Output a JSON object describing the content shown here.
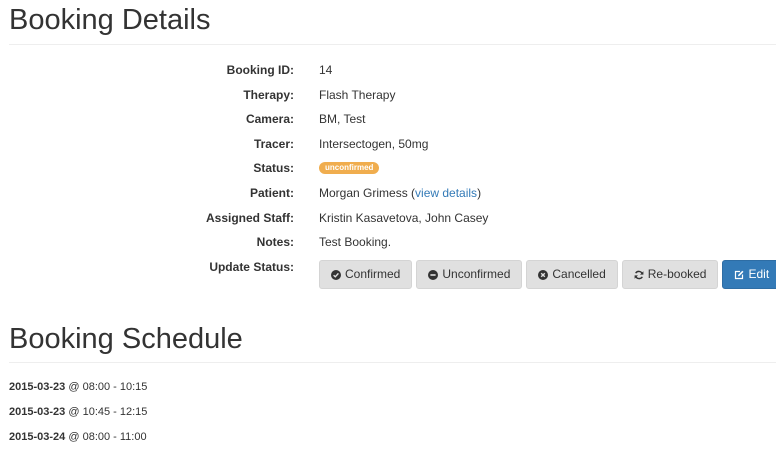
{
  "details": {
    "title": "Booking Details",
    "rows": [
      {
        "label": "Booking ID:",
        "value": "14"
      },
      {
        "label": "Therapy:",
        "value": "Flash Therapy"
      },
      {
        "label": "Camera:",
        "value": "BM, Test"
      },
      {
        "label": "Tracer:",
        "value": "Intersectogen, 50mg"
      },
      {
        "label": "Status:",
        "value": "unconfirmed"
      },
      {
        "label": "Patient:",
        "value": "Morgan Grimess",
        "link_open": "(",
        "link": "view details",
        "link_close": ")"
      },
      {
        "label": "Assigned Staff:",
        "value": "Kristin Kasavetova, John Casey"
      },
      {
        "label": "Notes:",
        "value": "Test Booking."
      },
      {
        "label": "Update Status:"
      }
    ],
    "status_color": "#f0ad4e",
    "buttons": [
      {
        "label": "Confirmed",
        "icon": "check-circle-icon"
      },
      {
        "label": "Unconfirmed",
        "icon": "minus-circle-icon"
      },
      {
        "label": "Cancelled",
        "icon": "times-circle-icon"
      },
      {
        "label": "Re-booked",
        "icon": "refresh-icon"
      },
      {
        "label": "Edit",
        "icon": "edit-icon",
        "color": "#337ab7"
      }
    ]
  },
  "schedule": {
    "title": "Booking Schedule",
    "items": [
      {
        "date": "2015-03-23",
        "sep": "@",
        "time": "08:00 - 10:15"
      },
      {
        "date": "2015-03-23",
        "sep": "@",
        "time": "10:45 - 12:15"
      },
      {
        "date": "2015-03-24",
        "sep": "@",
        "time": "08:00 - 11:00"
      }
    ]
  }
}
